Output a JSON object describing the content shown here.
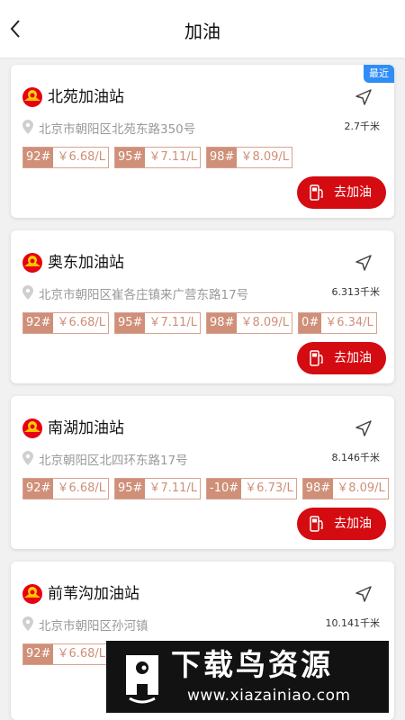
{
  "header": {
    "title": "加油"
  },
  "stations": [
    {
      "name": "北苑加油站",
      "badge": "最近",
      "address": "北京市朝阳区北苑东路350号",
      "distance": "2.7千米",
      "prices": [
        {
          "type": "92#",
          "price": "￥6.68/L"
        },
        {
          "type": "95#",
          "price": "￥7.11/L"
        },
        {
          "type": "98#",
          "price": "￥8.09/L"
        }
      ],
      "button": "去加油"
    },
    {
      "name": "奥东加油站",
      "address": "北京市朝阳区崔各庄镇来广营东路17号",
      "distance": "6.313千米",
      "prices": [
        {
          "type": "92#",
          "price": "￥6.68/L"
        },
        {
          "type": "95#",
          "price": "￥7.11/L"
        },
        {
          "type": "98#",
          "price": "￥8.09/L"
        },
        {
          "type": "0#",
          "price": "￥6.34/L"
        }
      ],
      "button": "去加油"
    },
    {
      "name": "南湖加油站",
      "address": "北京朝阳区北四环东路17号",
      "distance": "8.146千米",
      "prices": [
        {
          "type": "92#",
          "price": "￥6.68/L"
        },
        {
          "type": "95#",
          "price": "￥7.11/L"
        },
        {
          "type": "-10#",
          "price": "￥6.73/L"
        },
        {
          "type": "98#",
          "price": "￥8.09/L"
        }
      ],
      "button": "去加油"
    },
    {
      "name": "前苇沟加油站",
      "address": "北京市朝阳区孙河镇",
      "distance": "10.141千米",
      "prices": [
        {
          "type": "92#",
          "price": "￥6.68/L"
        }
      ]
    }
  ],
  "watermark": {
    "title": "下载鸟资源",
    "url": "www.xiazainiao.com"
  },
  "colors": {
    "accent": "#d40b10",
    "price_tag": "#cf8f78",
    "badge": "#2f8df5"
  }
}
